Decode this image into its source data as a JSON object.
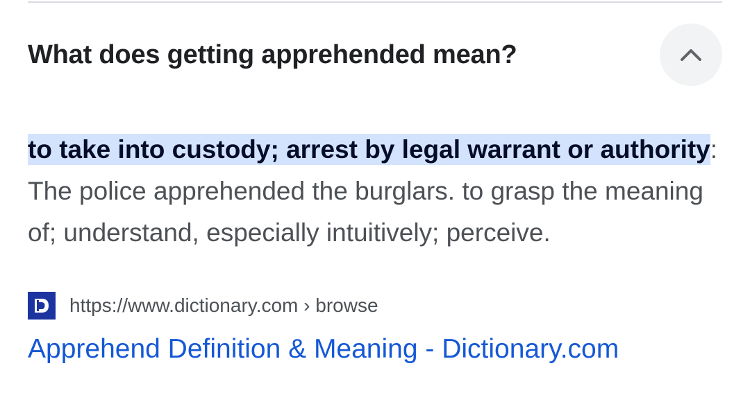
{
  "question": {
    "text": "What does getting apprehended mean?",
    "collapse_icon": "chevron-up-icon"
  },
  "answer": {
    "highlighted": "to take into custody; arrest by legal warrant or authority",
    "separator": ":",
    "rest": " The police apprehended the burglars. to grasp the meaning of; understand, especially intuitively; perceive."
  },
  "source": {
    "favicon_icon": "dictionary-logo-icon",
    "favicon_letter": "D",
    "url": "https://www.dictionary.com › browse",
    "title": "Apprehend Definition & Meaning - Dictionary.com"
  },
  "colors": {
    "highlight_bg": "#d3e3fd",
    "link": "#1558d6",
    "favicon_bg": "#1c34a0"
  }
}
